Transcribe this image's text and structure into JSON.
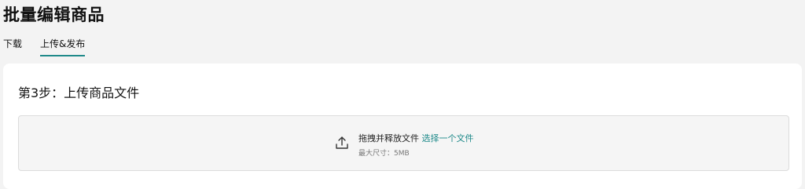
{
  "page": {
    "title": "批量编辑商品"
  },
  "tabs": [
    {
      "label": "下载",
      "active": false
    },
    {
      "label": "上传&发布",
      "active": true
    }
  ],
  "step": {
    "title": "第3步：上传商品文件"
  },
  "dropzone": {
    "prompt": "拖拽并释放文件",
    "link_label": "选择一个文件",
    "size_hint": "最大尺寸：5MB",
    "icon": "upload-icon"
  },
  "colors": {
    "accent": "#1f8a8a",
    "background": "#f3f3f3",
    "card": "#ffffff"
  }
}
